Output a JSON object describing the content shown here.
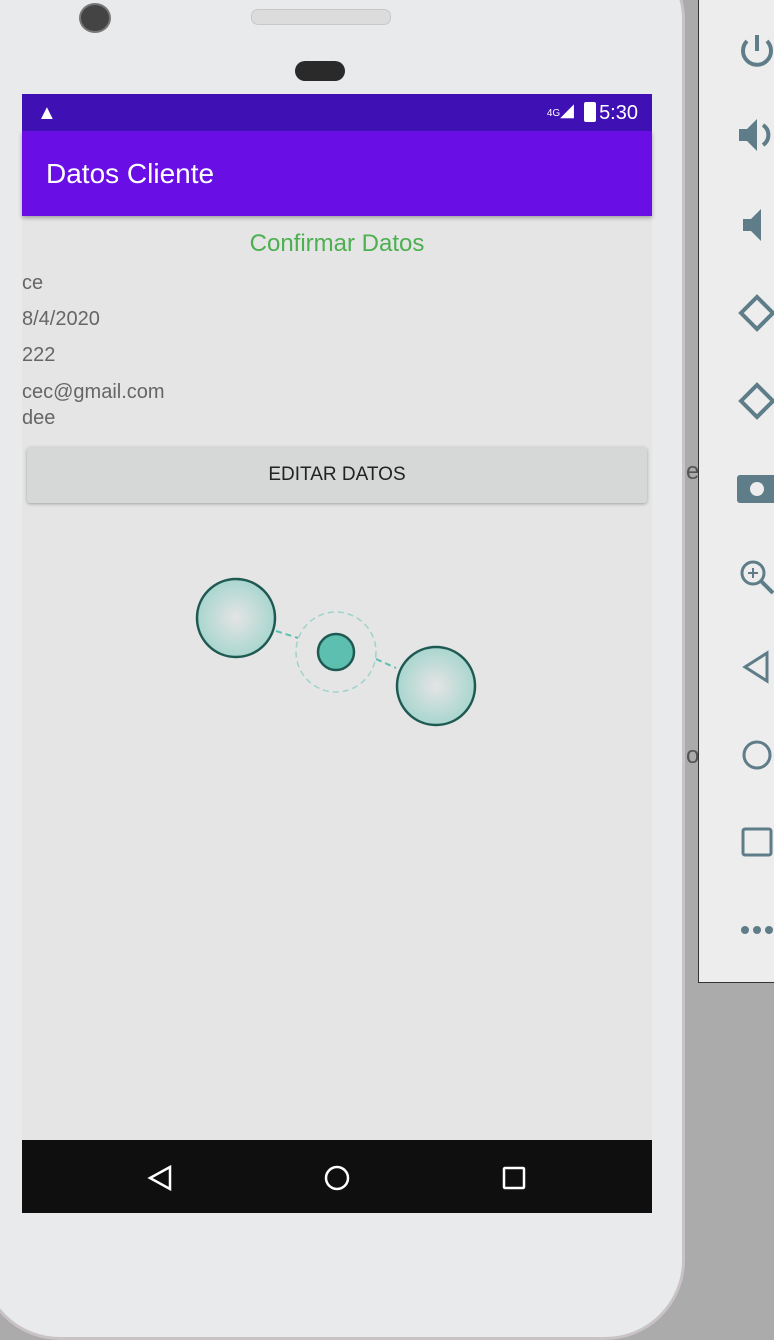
{
  "status_bar": {
    "time": "5:30",
    "network": "4G"
  },
  "app_bar": {
    "title": "Datos Cliente"
  },
  "content": {
    "heading": "Confirmar Datos",
    "fields": [
      "ce",
      "8/4/2020",
      "222",
      "cec@gmail.com",
      "dee"
    ],
    "edit_button": "EDITAR DATOS"
  },
  "colors": {
    "status_bar": "#3f10b3",
    "app_bar": "#690fe5",
    "heading": "#4caf50",
    "loader": "#5dbfb0"
  },
  "side_text": {
    "e": "e",
    "arrow": "↑",
    "o": "o"
  }
}
